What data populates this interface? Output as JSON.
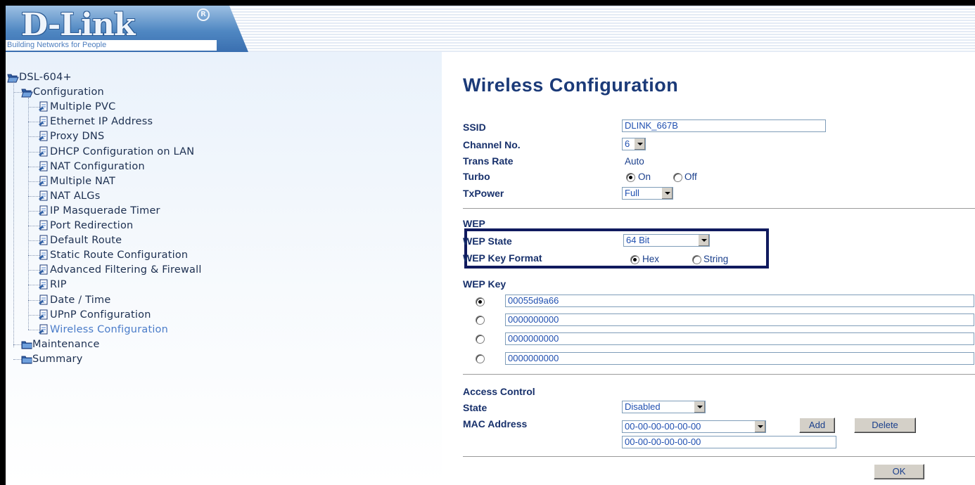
{
  "brand": {
    "logo": "D-Link",
    "tagline": "Building Networks for People"
  },
  "sidebar": {
    "root": "DSL-604+",
    "configuration": "Configuration",
    "items": [
      "Multiple PVC",
      "Ethernet IP Address",
      "Proxy DNS",
      "DHCP Configuration on LAN",
      "NAT Configuration",
      "Multiple NAT",
      "NAT ALGs",
      "IP Masquerade Timer",
      "Port Redirection",
      "Default Route",
      "Static Route Configuration",
      "Advanced Filtering & Firewall",
      "RIP",
      "Date / Time",
      "UPnP Configuration",
      "Wireless Configuration"
    ],
    "active_item": "Wireless Configuration",
    "maintenance": "Maintenance",
    "summary": "Summary"
  },
  "page": {
    "title": "Wireless Configuration"
  },
  "wireless": {
    "ssid_label": "SSID",
    "ssid_value": "DLINK_667B",
    "channel_label": "Channel No.",
    "channel_value": "6",
    "trans_rate_label": "Trans Rate",
    "trans_rate_value": "Auto",
    "turbo_label": "Turbo",
    "turbo_on": "On",
    "turbo_off": "Off",
    "turbo_selected": "On",
    "txpower_label": "TxPower",
    "txpower_value": "Full"
  },
  "wep": {
    "section_label": "WEP",
    "state_label": "WEP State",
    "state_value": "64 Bit",
    "key_format_label": "WEP Key Format",
    "format_hex": "Hex",
    "format_string": "String",
    "format_selected": "Hex",
    "key_label": "WEP Key",
    "keys": [
      "00055d9a66",
      "0000000000",
      "0000000000",
      "0000000000"
    ],
    "selected_key_index": 0
  },
  "access_control": {
    "section_label": "Access Control",
    "state_label": "State",
    "state_value": "Disabled",
    "mac_label": "MAC Address",
    "mac_select_value": "00-00-00-00-00-00",
    "mac_input_value": "00-00-00-00-00-00",
    "add_label": "Add",
    "delete_label": "Delete"
  },
  "footer": {
    "ok_label": "OK"
  },
  "colors": {
    "title": "#1b3a78",
    "label": "#17306b",
    "value": "#1a3f8c",
    "highlight_box": "#101a5e",
    "active_nav": "#4a7cc9"
  }
}
